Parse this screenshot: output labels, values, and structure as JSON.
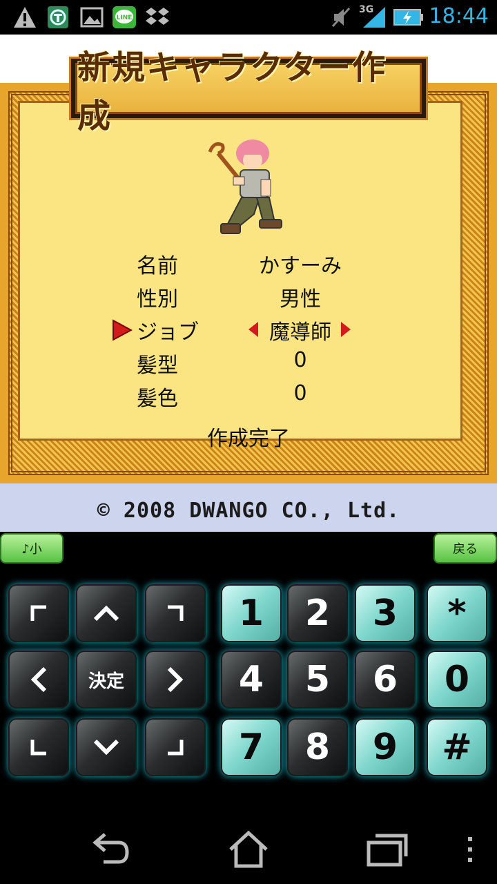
{
  "status_bar": {
    "time": "18:44",
    "network": "3G",
    "icons": [
      "warning-icon",
      "vpn-shield-icon",
      "gallery-icon",
      "line-app-icon",
      "dropbox-icon",
      "mute-icon",
      "signal-icon",
      "battery-charging-icon"
    ]
  },
  "game": {
    "title": "新規キャラクター作成",
    "rows": [
      {
        "label": "名前",
        "value": "かすーみ"
      },
      {
        "label": "性別",
        "value": "男性"
      },
      {
        "label": "ジョブ",
        "value": "魔導師"
      },
      {
        "label": "髪型",
        "value": "0"
      },
      {
        "label": "髪色",
        "value": "0"
      }
    ],
    "create_done": "作成完了",
    "copyright": "© 2008 DWANGO CO., Ltd."
  },
  "keypad": {
    "sound_button": "♪小",
    "back_button": "戻る",
    "enter_key": "決定",
    "digits": [
      "1",
      "2",
      "3",
      "*",
      "4",
      "5",
      "6",
      "0",
      "7",
      "8",
      "9",
      "#"
    ]
  },
  "nav_bar": {
    "icons": [
      "back-icon",
      "home-icon",
      "recent-apps-icon",
      "menu-icon"
    ]
  }
}
